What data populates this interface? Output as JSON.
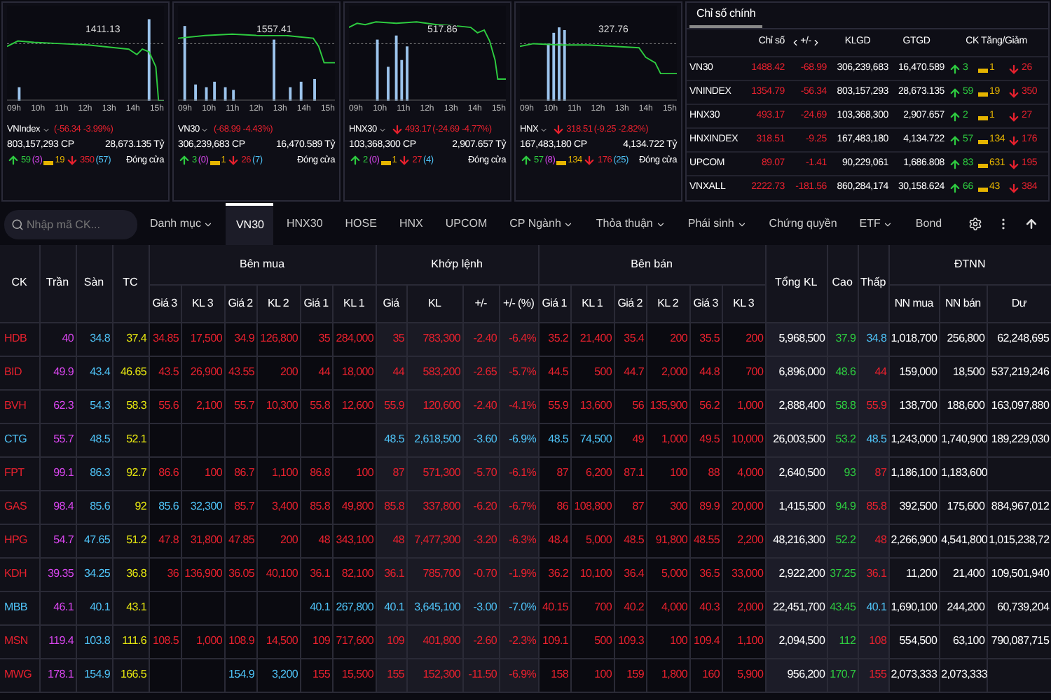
{
  "charts": [
    {
      "name": "VNIndex",
      "value_label": "1411.13",
      "change": "(-56.34 -3.99%)",
      "volume": "803,157,293 CP",
      "value": "28,673.135 Tỷ",
      "up": "59",
      "ceiling": "(3)",
      "ref": "19",
      "down": "350",
      "floor": "(57)",
      "status": "Đóng cửa",
      "times": [
        "09h",
        "10h",
        "11h",
        "12h",
        "13h",
        "14h",
        "15h"
      ]
    },
    {
      "name": "VN30",
      "value_label": "1557.41",
      "change": "(-68.99 -4.43%)",
      "volume": "306,239,683 CP",
      "value": "16,470.589 Tỷ",
      "up": "3",
      "ceiling": "(0)",
      "ref": "1",
      "down": "26",
      "floor": "(7)",
      "status": "Đóng cửa",
      "times": [
        "09h",
        "10h",
        "11h",
        "12h",
        "13h",
        "14h",
        "15h"
      ]
    },
    {
      "name": "HNX30",
      "value_label": "517.86",
      "index_value": "493.17",
      "change": "(-24.69 -4.77%)",
      "volume": "103,368,300 CP",
      "value": "2,907.657 Tỷ",
      "up": "2",
      "ceiling": "(0)",
      "ref": "1",
      "down": "27",
      "floor": "(4)",
      "status": "Đóng cửa",
      "times": [
        "09h",
        "10h",
        "11h",
        "12h",
        "13h",
        "14h",
        "15h"
      ]
    },
    {
      "name": "HNX",
      "value_label": "327.76",
      "index_value": "318.51",
      "change": "(-9.25 -2.82%)",
      "volume": "167,483,180 CP",
      "value": "4,134.722 Tỷ",
      "up": "57",
      "ceiling": "(8)",
      "ref": "134",
      "down": "176",
      "floor": "(25)",
      "status": "Đóng cửa",
      "times": [
        "09h",
        "10h",
        "11h",
        "12h",
        "13h",
        "14h",
        "15h"
      ]
    }
  ],
  "index_panel": {
    "tabs": [
      {
        "label": "Chỉ số chính",
        "selected": true
      }
    ],
    "columns": [
      "Chỉ số",
      "+/-",
      "KLGD",
      "GTGD",
      "CK Tăng/Giảm"
    ],
    "rows": [
      {
        "name": "VN30",
        "value": "1488.42",
        "change": "-68.99",
        "volume": "306,239,683",
        "turnover": "16,470.589",
        "up": "3",
        "ref": "1",
        "down": "26"
      },
      {
        "name": "VNINDEX",
        "value": "1354.79",
        "change": "-56.34",
        "volume": "803,157,293",
        "turnover": "28,673.135",
        "up": "59",
        "ref": "19",
        "down": "350"
      },
      {
        "name": "HNX30",
        "value": "493.17",
        "change": "-24.69",
        "volume": "103,368,300",
        "turnover": "2,907.657",
        "up": "2",
        "ref": "1",
        "down": "27"
      },
      {
        "name": "HNXINDEX",
        "value": "318.51",
        "change": "-9.25",
        "volume": "167,483,180",
        "turnover": "4,134.722",
        "up": "57",
        "ref": "134",
        "down": "176"
      },
      {
        "name": "UPCOM",
        "value": "89.07",
        "change": "-1.41",
        "volume": "90,229,061",
        "turnover": "1,686.808",
        "up": "83",
        "ref": "631",
        "down": "195"
      },
      {
        "name": "VNXALL",
        "value": "2222.73",
        "change": "-181.56",
        "volume": "860,284,174",
        "turnover": "30,158.624",
        "up": "66",
        "ref": "43",
        "down": "384"
      }
    ]
  },
  "search": {
    "placeholder": "Nhập mã CK..."
  },
  "tabs": [
    {
      "label": "Danh mục",
      "dropdown": true,
      "selected": false
    },
    {
      "label": "VN30",
      "dropdown": false,
      "selected": true
    },
    {
      "label": "HNX30",
      "dropdown": false,
      "selected": false
    },
    {
      "label": "HOSE",
      "dropdown": false,
      "selected": false
    },
    {
      "label": "HNX",
      "dropdown": false,
      "selected": false
    },
    {
      "label": "UPCOM",
      "dropdown": false,
      "selected": false
    },
    {
      "label": "CP Ngành",
      "dropdown": true,
      "selected": false
    },
    {
      "label": "Thỏa thuận",
      "dropdown": true,
      "selected": false
    },
    {
      "label": "Phái sinh",
      "dropdown": true,
      "selected": false
    },
    {
      "label": "Chứng quyền",
      "dropdown": false,
      "selected": false
    },
    {
      "label": "ETF",
      "dropdown": true,
      "selected": false
    },
    {
      "label": "Bond",
      "dropdown": false,
      "selected": false
    }
  ],
  "board": {
    "columns": [
      {
        "label": "CK"
      },
      {
        "label": "Trần"
      },
      {
        "label": "Sàn"
      },
      {
        "label": "TC"
      },
      {
        "label": "Bên mua",
        "sub": [
          "Giá 3",
          "KL 3",
          "Giá 2",
          "KL 2",
          "Giá 1",
          "KL 1"
        ]
      },
      {
        "label": "Khớp lệnh",
        "sub": [
          "Giá",
          "KL",
          "+/-",
          "+/- (%)"
        ]
      },
      {
        "label": "Bên bán",
        "sub": [
          "Giá 1",
          "KL 1",
          "Giá 2",
          "KL 2",
          "Giá 3",
          "KL 3"
        ]
      },
      {
        "label": "Tổng KL"
      },
      {
        "label": "Cao"
      },
      {
        "label": "Thấp"
      },
      {
        "label": "ĐTNN",
        "sub": [
          "NN mua",
          "NN bán",
          "Dư"
        ]
      }
    ],
    "rows": [
      {
        "symbol": "HDB",
        "ceiling": "40",
        "floor": "34.8",
        "ref": "37.4",
        "bids": {
          "level_3": {
            "price": "34.85",
            "volume": "17,500",
            "color": "#e8212e"
          },
          "level_2": {
            "price": "34.9",
            "volume": "126,800",
            "color": "#e8212e"
          },
          "level_1": {
            "price": "35",
            "volume": "284,000",
            "color": "#e8212e"
          }
        },
        "match": {
          "price": "35",
          "volume": "783,300",
          "change": "-2.40",
          "percent": "-6.4%",
          "color": "#e8212e"
        },
        "asks": {
          "level_1": {
            "price": "35.2",
            "volume": "21,400",
            "color": "#e8212e"
          },
          "level_2": {
            "price": "35.4",
            "volume": "200",
            "color": "#e8212e"
          },
          "level_3": {
            "price": "35.5",
            "volume": "200",
            "color": "#e8212e"
          }
        },
        "total": "5,968,500",
        "high": {
          "text": "37.9",
          "color": "#2ecc40"
        },
        "low": {
          "text": "34.8",
          "color": "#4fc3f7"
        },
        "foreign_buy": "1,018,700",
        "foreign_sell": "256,800",
        "room": "62,248,695"
      },
      {
        "symbol": "BID",
        "ceiling": "49.9",
        "floor": "43.4",
        "ref": "46.65",
        "bids": {
          "level_3": {
            "price": "43.5",
            "volume": "26,900",
            "color": "#e8212e"
          },
          "level_2": {
            "price": "43.55",
            "volume": "200",
            "color": "#e8212e"
          },
          "level_1": {
            "price": "44",
            "volume": "18,000",
            "color": "#e8212e"
          }
        },
        "match": {
          "price": "44",
          "volume": "583,200",
          "change": "-2.65",
          "percent": "-5.7%",
          "color": "#e8212e"
        },
        "asks": {
          "level_1": {
            "price": "44.5",
            "volume": "500",
            "color": "#e8212e"
          },
          "level_2": {
            "price": "44.7",
            "volume": "2,000",
            "color": "#e8212e"
          },
          "level_3": {
            "price": "44.8",
            "volume": "700",
            "color": "#e8212e"
          }
        },
        "total": "6,896,000",
        "high": {
          "text": "48.6",
          "color": "#2ecc40"
        },
        "low": {
          "text": "44",
          "color": "#e8212e"
        },
        "foreign_buy": "159,000",
        "foreign_sell": "18,500",
        "room": "537,219,246"
      },
      {
        "symbol": "BVH",
        "ceiling": "62.3",
        "floor": "54.3",
        "ref": "58.3",
        "bids": {
          "level_3": {
            "price": "55.6",
            "volume": "2,100",
            "color": "#e8212e"
          },
          "level_2": {
            "price": "55.7",
            "volume": "10,300",
            "color": "#e8212e"
          },
          "level_1": {
            "price": "55.8",
            "volume": "12,600",
            "color": "#e8212e"
          }
        },
        "match": {
          "price": "55.9",
          "volume": "120,600",
          "change": "-2.40",
          "percent": "-4.1%",
          "color": "#e8212e"
        },
        "asks": {
          "level_1": {
            "price": "55.9",
            "volume": "13,600",
            "color": "#e8212e"
          },
          "level_2": {
            "price": "56",
            "volume": "135,900",
            "color": "#e8212e"
          },
          "level_3": {
            "price": "56.2",
            "volume": "1,000",
            "color": "#e8212e"
          }
        },
        "total": "2,888,400",
        "high": {
          "text": "58.8",
          "color": "#2ecc40"
        },
        "low": {
          "text": "55.9",
          "color": "#e8212e"
        },
        "foreign_buy": "138,700",
        "foreign_sell": "188,600",
        "room": "163,097,880"
      },
      {
        "symbol": "CTG",
        "ceiling": "55.7",
        "floor": "48.5",
        "ref": "52.1",
        "bids": {},
        "match": {
          "price": "48.5",
          "volume": "2,618,500",
          "change": "-3.60",
          "percent": "-6.9%",
          "color": "#4fc3f7"
        },
        "asks": {
          "level_1": {
            "price": "48.5",
            "volume": "74,500",
            "color": "#4fc3f7"
          },
          "level_2": {
            "price": "49",
            "volume": "1,000",
            "color": "#e8212e"
          },
          "level_3": {
            "price": "49.5",
            "volume": "10,000",
            "color": "#e8212e"
          }
        },
        "total": "26,003,500",
        "high": {
          "text": "53.2",
          "color": "#2ecc40"
        },
        "low": {
          "text": "48.5",
          "color": "#4fc3f7"
        },
        "foreign_buy": "1,243,000",
        "foreign_sell": "1,740,900",
        "room": "189,229,030"
      },
      {
        "symbol": "FPT",
        "ceiling": "99.1",
        "floor": "86.3",
        "ref": "92.7",
        "bids": {
          "level_3": {
            "price": "86.6",
            "volume": "100",
            "color": "#e8212e"
          },
          "level_2": {
            "price": "86.7",
            "volume": "1,100",
            "color": "#e8212e"
          },
          "level_1": {
            "price": "86.8",
            "volume": "100",
            "color": "#e8212e"
          }
        },
        "match": {
          "price": "87",
          "volume": "571,300",
          "change": "-5.70",
          "percent": "-6.1%",
          "color": "#e8212e"
        },
        "asks": {
          "level_1": {
            "price": "87",
            "volume": "6,200",
            "color": "#e8212e"
          },
          "level_2": {
            "price": "87.1",
            "volume": "100",
            "color": "#e8212e"
          },
          "level_3": {
            "price": "88",
            "volume": "4,000",
            "color": "#e8212e"
          }
        },
        "total": "2,640,500",
        "high": {
          "text": "93",
          "color": "#2ecc40"
        },
        "low": {
          "text": "87",
          "color": "#e8212e"
        },
        "foreign_buy": "1,186,100",
        "foreign_sell": "1,183,600"
      },
      {
        "symbol": "GAS",
        "ceiling": "98.4",
        "floor": "85.6",
        "ref": "92",
        "bids": {
          "level_3": {
            "price": "85.6",
            "volume": "32,300",
            "color": "#4fc3f7"
          },
          "level_2": {
            "price": "85.7",
            "volume": "3,400",
            "color": "#e8212e"
          },
          "level_1": {
            "price": "85.8",
            "volume": "49,800",
            "color": "#e8212e"
          }
        },
        "match": {
          "price": "85.8",
          "volume": "337,800",
          "change": "-6.20",
          "percent": "-6.7%",
          "color": "#e8212e"
        },
        "asks": {
          "level_1": {
            "price": "86",
            "volume": "108,800",
            "color": "#e8212e"
          },
          "level_2": {
            "price": "87",
            "volume": "300",
            "color": "#e8212e"
          },
          "level_3": {
            "price": "89.9",
            "volume": "20,000",
            "color": "#e8212e"
          }
        },
        "total": "1,415,500",
        "high": {
          "text": "94.9",
          "color": "#2ecc40"
        },
        "low": {
          "text": "85.8",
          "color": "#e8212e"
        },
        "foreign_buy": "392,500",
        "foreign_sell": "175,600",
        "room": "884,967,012"
      },
      {
        "symbol": "HPG",
        "ceiling": "54.7",
        "floor": "47.65",
        "ref": "51.2",
        "bids": {
          "level_3": {
            "price": "47.8",
            "volume": "31,800",
            "color": "#e8212e"
          },
          "level_2": {
            "price": "47.85",
            "volume": "200",
            "color": "#e8212e"
          },
          "level_1": {
            "price": "48",
            "volume": "343,100",
            "color": "#e8212e"
          }
        },
        "match": {
          "price": "48",
          "volume": "7,477,300",
          "change": "-3.20",
          "percent": "-6.3%",
          "color": "#e8212e"
        },
        "asks": {
          "level_1": {
            "price": "48.4",
            "volume": "5,000",
            "color": "#e8212e"
          },
          "level_2": {
            "price": "48.5",
            "volume": "91,800",
            "color": "#e8212e"
          },
          "level_3": {
            "price": "48.55",
            "volume": "2,200",
            "color": "#e8212e"
          }
        },
        "total": "48,216,300",
        "high": {
          "text": "52.2",
          "color": "#2ecc40"
        },
        "low": {
          "text": "48",
          "color": "#e8212e"
        },
        "foreign_buy": "2,266,900",
        "foreign_sell": "4,541,800",
        "room": "1,015,238,72"
      },
      {
        "symbol": "KDH",
        "ceiling": "39.35",
        "floor": "34.25",
        "ref": "36.8",
        "bids": {
          "level_3": {
            "price": "36",
            "volume": "136,900",
            "color": "#e8212e"
          },
          "level_2": {
            "price": "36.05",
            "volume": "40,100",
            "color": "#e8212e"
          },
          "level_1": {
            "price": "36.1",
            "volume": "82,100",
            "color": "#e8212e"
          }
        },
        "match": {
          "price": "36.1",
          "volume": "785,700",
          "change": "-0.70",
          "percent": "-1.9%",
          "color": "#e8212e"
        },
        "asks": {
          "level_1": {
            "price": "36.2",
            "volume": "10,100",
            "color": "#e8212e"
          },
          "level_2": {
            "price": "36.4",
            "volume": "5,000",
            "color": "#e8212e"
          },
          "level_3": {
            "price": "36.5",
            "volume": "33,000",
            "color": "#e8212e"
          }
        },
        "total": "2,922,200",
        "high": {
          "text": "37.25",
          "color": "#2ecc40"
        },
        "low": {
          "text": "36.1",
          "color": "#e8212e"
        },
        "foreign_buy": "11,200",
        "foreign_sell": "21,400",
        "room": "109,501,940"
      },
      {
        "symbol": "MBB",
        "ceiling": "46.1",
        "floor": "40.1",
        "ref": "43.1",
        "bids": {
          "level_1": {
            "price": "40.1",
            "volume": "267,800",
            "color": "#4fc3f7"
          }
        },
        "match": {
          "price": "40.1",
          "volume": "3,645,100",
          "change": "-3.00",
          "percent": "-7.0%",
          "color": "#4fc3f7"
        },
        "asks": {
          "level_1": {
            "price": "40.15",
            "volume": "700",
            "color": "#e8212e"
          },
          "level_2": {
            "price": "40.2",
            "volume": "4,000",
            "color": "#e8212e"
          },
          "level_3": {
            "price": "40.3",
            "volume": "2,000",
            "color": "#e8212e"
          }
        },
        "total": "22,451,700",
        "high": {
          "text": "43.45",
          "color": "#2ecc40"
        },
        "low": {
          "text": "40.1",
          "color": "#4fc3f7"
        },
        "foreign_buy": "1,690,100",
        "foreign_sell": "244,200",
        "room": "60,739,204"
      },
      {
        "symbol": "MSN",
        "ceiling": "119.4",
        "floor": "103.8",
        "ref": "111.6",
        "bids": {
          "level_3": {
            "price": "108.5",
            "volume": "1,000",
            "color": "#e8212e"
          },
          "level_2": {
            "price": "108.9",
            "volume": "14,500",
            "color": "#e8212e"
          },
          "level_1": {
            "price": "109",
            "volume": "717,600",
            "color": "#e8212e"
          }
        },
        "match": {
          "price": "109",
          "volume": "401,800",
          "change": "-2.60",
          "percent": "-2.3%",
          "color": "#e8212e"
        },
        "asks": {
          "level_1": {
            "price": "109.1",
            "volume": "500",
            "color": "#e8212e"
          },
          "level_2": {
            "price": "109.3",
            "volume": "100",
            "color": "#e8212e"
          },
          "level_3": {
            "price": "109.4",
            "volume": "1,100",
            "color": "#e8212e"
          }
        },
        "total": "2,094,500",
        "high": {
          "text": "112",
          "color": "#2ecc40"
        },
        "low": {
          "text": "108",
          "color": "#e8212e"
        },
        "foreign_buy": "554,500",
        "foreign_sell": "63,100",
        "room": "790,087,715"
      },
      {
        "symbol": "MWG",
        "ceiling": "178.1",
        "floor": "154.9",
        "ref": "166.5",
        "bids": {
          "level_2": {
            "price": "154.9",
            "volume": "3,200",
            "color": "#4fc3f7"
          },
          "level_1": {
            "price": "155",
            "volume": "15,500",
            "color": "#e8212e"
          }
        },
        "match": {
          "price": "155",
          "volume": "152,300",
          "change": "-11.50",
          "percent": "-6.9%",
          "color": "#e8212e"
        },
        "asks": {
          "level_1": {
            "price": "158",
            "volume": "100",
            "color": "#e8212e"
          },
          "level_2": {
            "price": "159",
            "volume": "1,800",
            "color": "#e8212e"
          },
          "level_3": {
            "price": "160",
            "volume": "5,900",
            "color": "#e8212e"
          }
        },
        "total": "956,200",
        "high": {
          "text": "170.7",
          "color": "#2ecc40"
        },
        "low": {
          "text": "155",
          "color": "#e8212e"
        },
        "foreign_buy": "2,073,333",
        "foreign_sell": "2,073,333"
      }
    ]
  }
}
